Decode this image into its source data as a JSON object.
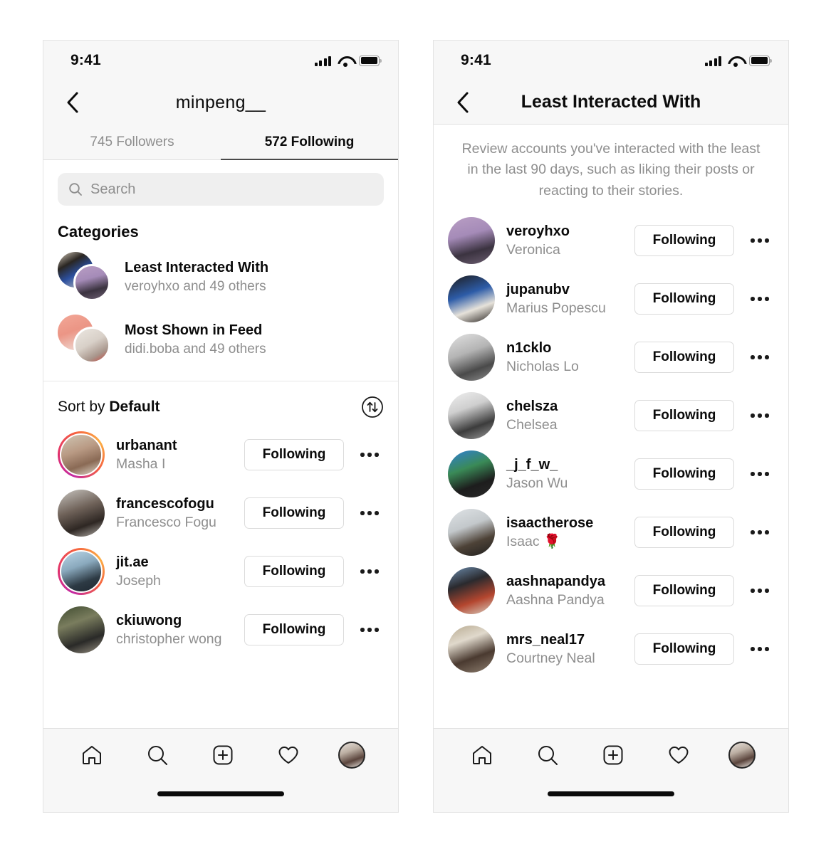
{
  "status_bar": {
    "time": "9:41",
    "icons": [
      "signal-icon",
      "wifi-icon",
      "battery-icon"
    ]
  },
  "left_phone": {
    "nav": {
      "back": "back-chevron-icon",
      "title": "minpeng__"
    },
    "tabs": [
      {
        "label": "745 Followers",
        "active": false
      },
      {
        "label": "572 Following",
        "active": true
      }
    ],
    "search": {
      "placeholder": "Search",
      "icon": "search-icon"
    },
    "categories_heading": "Categories",
    "categories": [
      {
        "title": "Least Interacted With",
        "subtitle": "veroyhxo and 49 others"
      },
      {
        "title": "Most Shown in Feed",
        "subtitle": "didi.boba and 49 others"
      }
    ],
    "sort": {
      "prefix": "Sort by ",
      "value": "Default",
      "icon": "sort-arrows-icon"
    },
    "users": [
      {
        "username": "urbanant",
        "fullname": "Masha I",
        "action": "Following",
        "has_story": true
      },
      {
        "username": "francescofogu",
        "fullname": "Francesco Fogu",
        "action": "Following",
        "has_story": false
      },
      {
        "username": "jit.ae",
        "fullname": "Joseph",
        "action": "Following",
        "has_story": true
      },
      {
        "username": "ckiuwong",
        "fullname": "christopher wong",
        "action": "Following",
        "has_story": false
      }
    ]
  },
  "right_phone": {
    "nav": {
      "back": "back-chevron-icon",
      "title": "Least Interacted With"
    },
    "description": "Review accounts you've interacted with the least in the last 90 days, such as liking their posts or reacting to their stories.",
    "users": [
      {
        "username": "veroyhxo",
        "fullname": "Veronica",
        "action": "Following"
      },
      {
        "username": "jupanubv",
        "fullname": "Marius Popescu",
        "action": "Following"
      },
      {
        "username": "n1cklo",
        "fullname": "Nicholas Lo",
        "action": "Following"
      },
      {
        "username": "chelsza",
        "fullname": "Chelsea",
        "action": "Following"
      },
      {
        "username": "_j_f_w_",
        "fullname": "Jason Wu",
        "action": "Following"
      },
      {
        "username": "isaactherose",
        "fullname": "Isaac 🌹",
        "action": "Following"
      },
      {
        "username": "aashnapandya",
        "fullname": "Aashna Pandya",
        "action": "Following"
      },
      {
        "username": "mrs_neal17",
        "fullname": "Courtney Neal",
        "action": "Following"
      }
    ]
  },
  "tab_bar": {
    "items": [
      "home-icon",
      "search-icon",
      "new-post-icon",
      "activity-heart-icon",
      "profile-avatar"
    ]
  },
  "colors": {
    "accent_story": "#e1306c",
    "text": "#0b0b0b",
    "muted": "#8e8e8e",
    "border": "#dbdbdb"
  }
}
